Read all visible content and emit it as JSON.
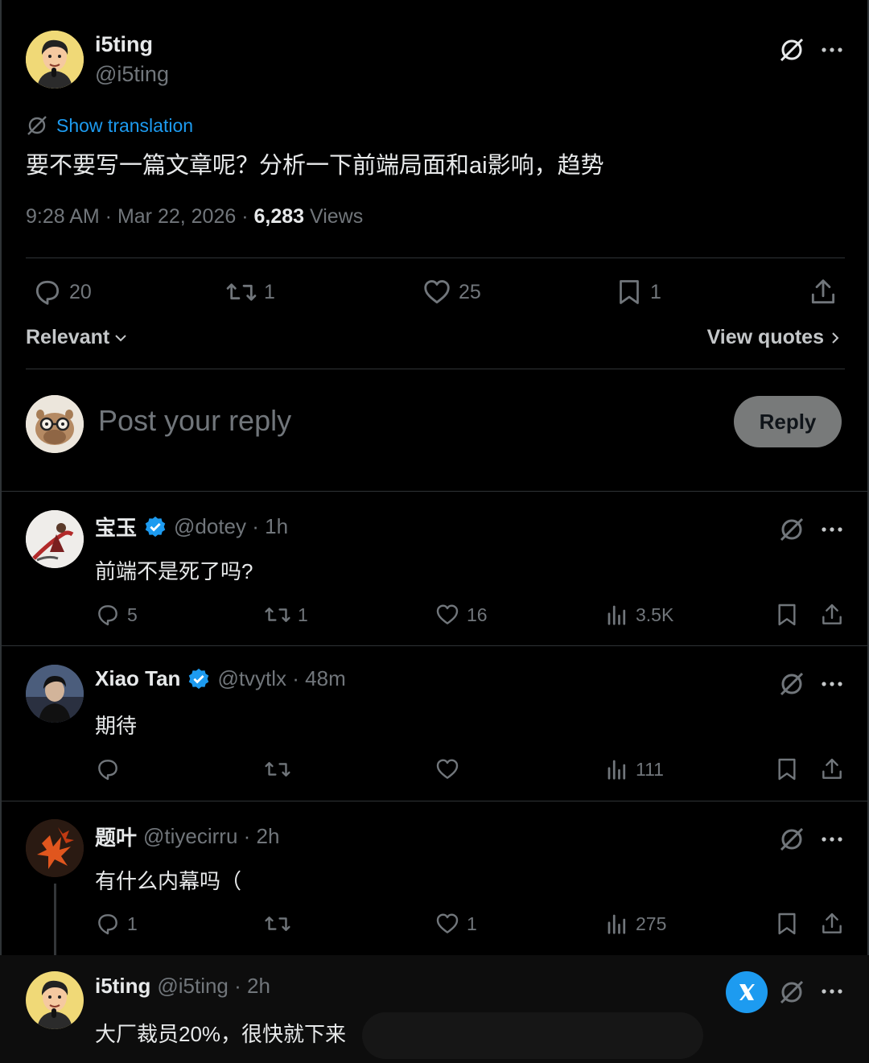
{
  "main_post": {
    "name": "i5ting",
    "handle": "@i5ting",
    "show_translation": "Show translation",
    "text": "要不要写一篇文章呢？分析一下前端局面和ai影响，趋势",
    "time": "9:28 AM · Mar 22, 2026 · ",
    "views_count": "6,283",
    "views_label": " Views",
    "stats": {
      "replies": "20",
      "reposts": "1",
      "likes": "25",
      "bookmarks": "1"
    }
  },
  "sort": {
    "label": "Relevant",
    "view_quotes": "View quotes"
  },
  "composer": {
    "placeholder": "Post your reply",
    "button": "Reply"
  },
  "replies": [
    {
      "name": "宝玉",
      "handle": "@dotey · 1h",
      "verified": true,
      "text": "前端不是死了吗?",
      "replies": "5",
      "reposts": "1",
      "likes": "16",
      "views": "3.5K"
    },
    {
      "name": "Xiao Tan",
      "handle": "@tvytlx · 48m",
      "verified": true,
      "text": "期待",
      "replies": "",
      "reposts": "",
      "likes": "",
      "views": "111"
    },
    {
      "name": "题叶",
      "handle": "@tiyecirru · 2h",
      "verified": false,
      "text": "有什么内幕吗（",
      "replies": "1",
      "reposts": "",
      "likes": "1",
      "views": "275"
    },
    {
      "name": "i5ting",
      "handle": "@i5ting · 2h",
      "verified": false,
      "text": "大厂裁员20%，很快就下来"
    }
  ],
  "colors": {
    "accent": "#1d9bf0",
    "muted": "#71767b",
    "text": "#e7e9ea",
    "divider": "#2f3336"
  }
}
